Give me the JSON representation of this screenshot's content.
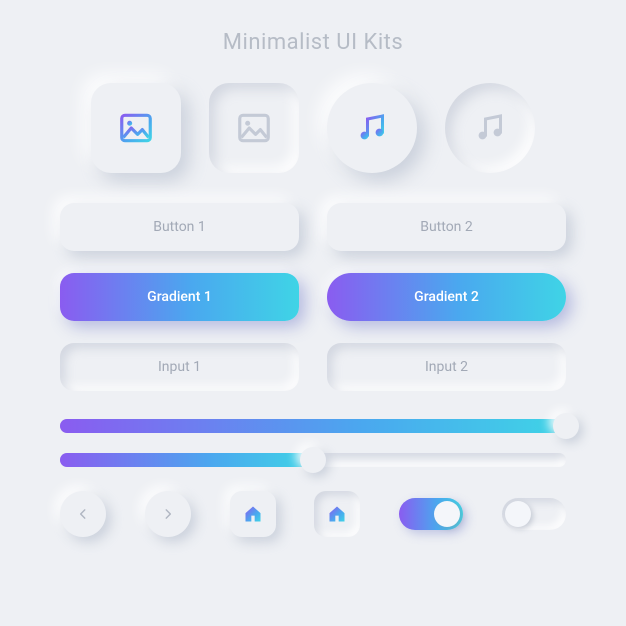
{
  "title": "Minimalist UI Kits",
  "icons": {
    "image_raised": "image-icon",
    "image_inset": "image-icon",
    "music_raised": "music-icon",
    "music_inset": "music-icon"
  },
  "buttons": {
    "neutral1": "Button 1",
    "neutral2": "Button 2",
    "gradient1": "Gradient 1",
    "gradient2": "Gradient 2"
  },
  "inputs": {
    "input1_placeholder": "Input 1",
    "input2_placeholder": "Input 2"
  },
  "sliders": {
    "slider1_percent": 100,
    "slider2_percent": 50
  },
  "toggles": {
    "toggle1_on": true,
    "toggle2_on": false
  },
  "colors": {
    "background": "#eef0f4",
    "text_muted": "#a2a9b6",
    "gradient_start": "#8a5cf0",
    "gradient_mid": "#4aa8ef",
    "gradient_end": "#3fd4e6"
  }
}
